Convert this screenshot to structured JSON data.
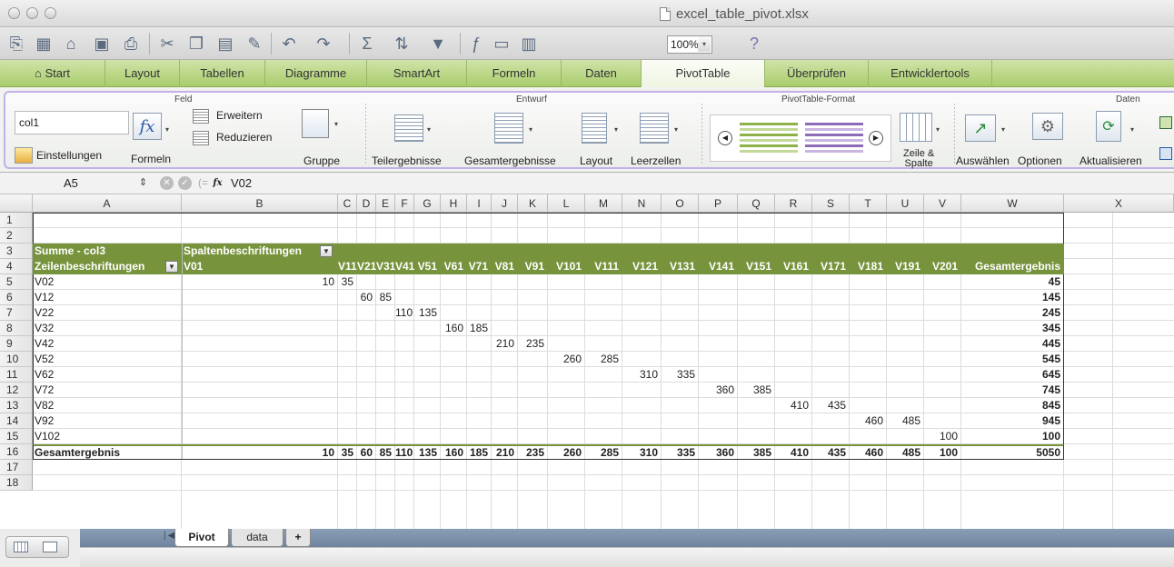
{
  "window": {
    "title": "excel_table_pivot.xlsx"
  },
  "toolbar": {
    "zoom": "100%"
  },
  "ribbon_tabs": [
    "Start",
    "Layout",
    "Tabellen",
    "Diagramme",
    "SmartArt",
    "Formeln",
    "Daten",
    "PivotTable",
    "Überprüfen",
    "Entwicklertools"
  ],
  "active_tab": "PivotTable",
  "ribbon": {
    "groups": {
      "feld": "Feld",
      "entwurf": "Entwurf",
      "format": "PivotTable-Format",
      "daten": "Daten"
    },
    "field_name": "col1",
    "einstellungen": "Einstellungen",
    "formeln": "Formeln",
    "erweitern": "Erweitern",
    "reduzieren": "Reduzieren",
    "gruppe": "Gruppe",
    "teilergebnisse": "Teilergebnisse",
    "gesamtergebnisse": "Gesamtergebnisse",
    "layout": "Layout",
    "leerzellen": "Leerzellen",
    "zeile_spalte_1": "Zeile &",
    "zeile_spalte_2": "Spalte",
    "auswaehlen": "Auswählen",
    "optionen": "Optionen",
    "aktualisieren": "Aktualisieren"
  },
  "formula_bar": {
    "cell_ref": "A5",
    "fx": "fx",
    "value": "V02"
  },
  "columns": [
    "A",
    "B",
    "C",
    "D",
    "E",
    "F",
    "G",
    "H",
    "I",
    "J",
    "K",
    "L",
    "M",
    "N",
    "O",
    "P",
    "Q",
    "R",
    "S",
    "T",
    "U",
    "V",
    "W",
    "X"
  ],
  "rows": [
    "1",
    "2",
    "3",
    "4",
    "5",
    "6",
    "7",
    "8",
    "9",
    "10",
    "11",
    "12",
    "13",
    "14",
    "15",
    "16",
    "17",
    "18"
  ],
  "pivot": {
    "sum_label": "Summe - col3",
    "col_labels": "Spaltenbeschriftungen",
    "row_labels": "Zeilenbeschriftungen",
    "col_headers": [
      "V01",
      "V11",
      "V21",
      "V31",
      "V41",
      "V51",
      "V61",
      "V71",
      "V81",
      "V91",
      "V101",
      "V111",
      "V121",
      "V131",
      "V141",
      "V151",
      "V161",
      "V171",
      "V181",
      "V191",
      "V201",
      "Gesamtergebnis"
    ],
    "row_names": [
      "V02",
      "V12",
      "V22",
      "V32",
      "V42",
      "V52",
      "V62",
      "V72",
      "V82",
      "V92",
      "V102"
    ],
    "row_values": [
      [
        "10",
        "35"
      ],
      [
        "60",
        "85"
      ],
      [
        "110",
        "135"
      ],
      [
        "160",
        "185"
      ],
      [
        "210",
        "235"
      ],
      [
        "260",
        "285"
      ],
      [
        "310",
        "335"
      ],
      [
        "360",
        "385"
      ],
      [
        "410",
        "435"
      ],
      [
        "460",
        "485"
      ],
      [
        "100"
      ]
    ],
    "row_totals": [
      "45",
      "145",
      "245",
      "345",
      "445",
      "545",
      "645",
      "745",
      "845",
      "945",
      "100"
    ],
    "grand_label": "Gesamtergebnis",
    "grand_values": [
      "10",
      "35",
      "60",
      "85",
      "110",
      "135",
      "160",
      "185",
      "210",
      "235",
      "260",
      "285",
      "310",
      "335",
      "360",
      "385",
      "410",
      "435",
      "460",
      "485",
      "100"
    ],
    "grand_total": "5050"
  },
  "sheets": [
    "Pivot",
    "data"
  ],
  "active_sheet": "Pivot"
}
